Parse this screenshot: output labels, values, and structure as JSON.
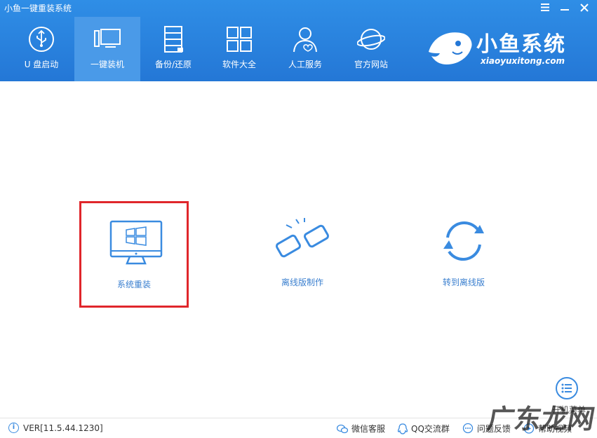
{
  "window": {
    "title": "小鱼一键重装系统",
    "controls": [
      "menu-icon",
      "minimize-icon",
      "close-icon"
    ]
  },
  "nav": {
    "items": [
      {
        "label": "U 盘启动",
        "icon": "usb-icon",
        "active": false
      },
      {
        "label": "一键装机",
        "icon": "install-icon",
        "active": true
      },
      {
        "label": "备份/还原",
        "icon": "backup-icon",
        "active": false
      },
      {
        "label": "软件大全",
        "icon": "apps-grid-icon",
        "active": false
      },
      {
        "label": "人工服务",
        "icon": "user-support-icon",
        "active": false
      },
      {
        "label": "官方网站",
        "icon": "globe-icon",
        "active": false
      }
    ]
  },
  "brand": {
    "name": "小鱼系统",
    "url": "xiaoyuxitong.com"
  },
  "options": [
    {
      "label": "系统重装",
      "icon": "monitor-windows-icon",
      "selected": true
    },
    {
      "label": "离线版制作",
      "icon": "broken-link-icon",
      "selected": false
    },
    {
      "label": "转到离线版",
      "icon": "refresh-icon",
      "selected": false
    }
  ],
  "menu_toggle": {
    "label": "开机菜单",
    "icon": "list-menu-icon"
  },
  "footer": {
    "version": "VER[11.5.44.1230]",
    "links": [
      {
        "label": "微信客服",
        "icon": "wechat-icon"
      },
      {
        "label": "QQ交流群",
        "icon": "qq-icon"
      },
      {
        "label": "问题反馈",
        "icon": "feedback-icon"
      },
      {
        "label": "帮助视频",
        "icon": "help-video-icon"
      }
    ]
  },
  "watermark": "广东龙网",
  "colors": {
    "header_blue": "#2477d6",
    "active_tab": "#4a9ae8",
    "accent_blue": "#3a8be0",
    "selection_red": "#e0262b"
  }
}
